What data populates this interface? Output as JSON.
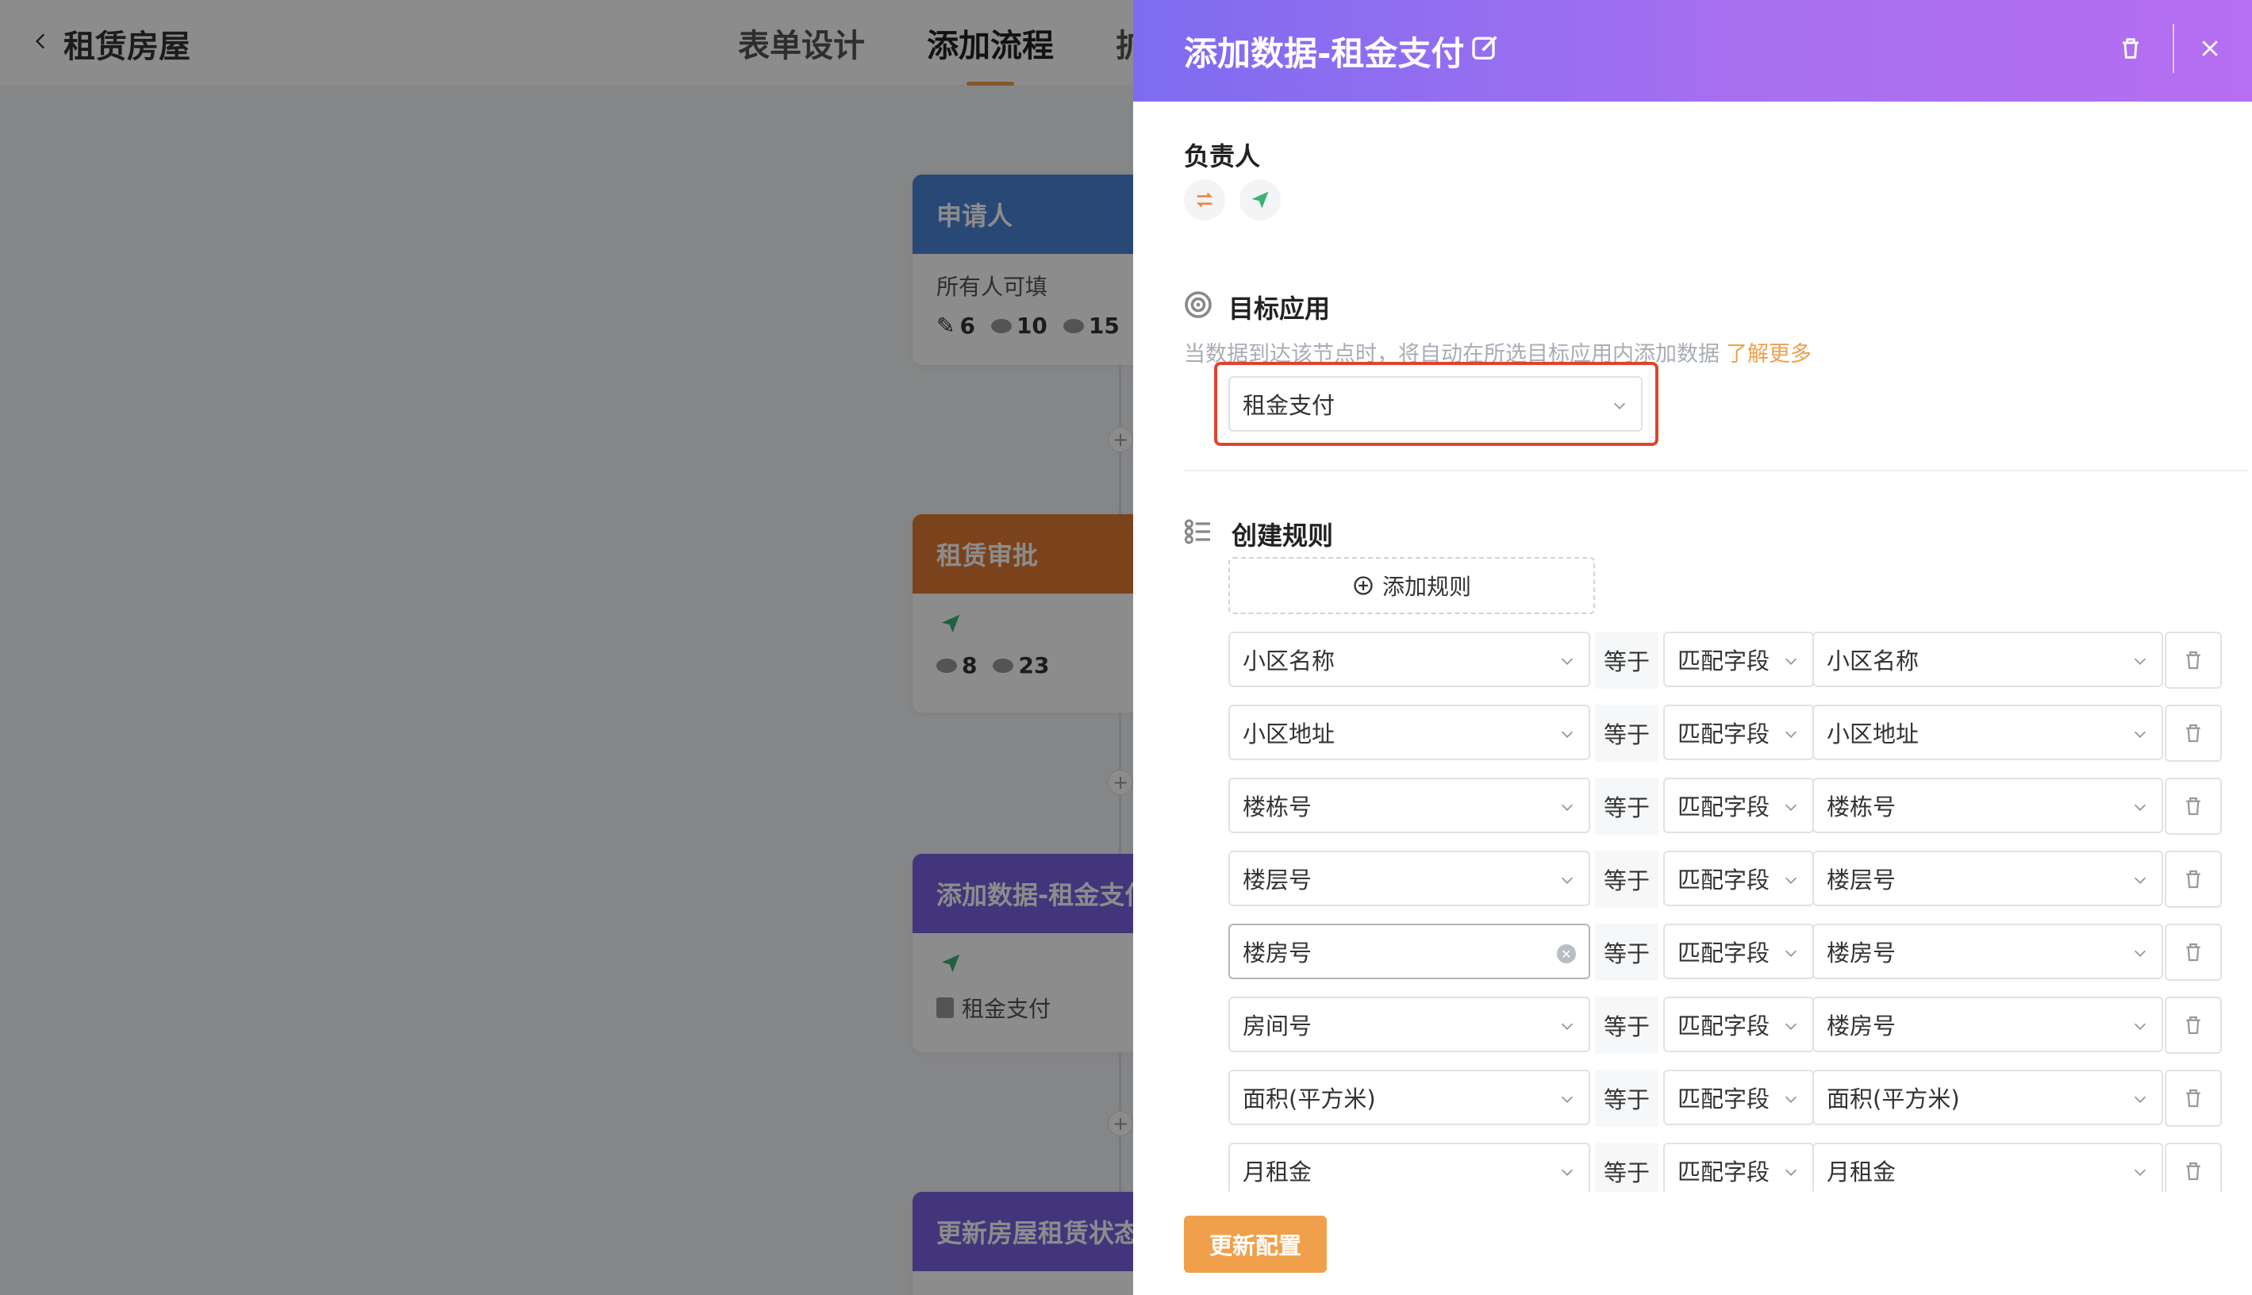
{
  "app": {
    "title": "租赁房屋",
    "tabs": [
      {
        "label": "表单设计"
      },
      {
        "label": "添加流程"
      },
      {
        "label": "扩"
      }
    ]
  },
  "flow": {
    "nodes": [
      {
        "title": "申请人",
        "color": "#4a86d8",
        "desc": "所有人可填",
        "stats": [
          "6",
          "10",
          "15"
        ]
      },
      {
        "title": "租赁审批",
        "color": "#e07b33",
        "stats": [
          "8",
          "23"
        ]
      },
      {
        "title": "添加数据-租金支付",
        "color": "#7b62e0",
        "app_name": "租金支付"
      },
      {
        "title": "更新房屋租赁状态",
        "color": "#7b62e0"
      }
    ]
  },
  "drawer": {
    "title": "添加数据-租金支付",
    "owner_label": "负责人",
    "target_label": "目标应用",
    "target_hint": "当数据到达该节点时，将自动在所选目标应用内添加数据",
    "learn_more": "了解更多",
    "target_app": "租金支付",
    "rules_label": "创建规则",
    "add_rule_label": "添加规则",
    "equals": "等于",
    "rules": [
      {
        "field": "小区名称",
        "mode": "匹配字段",
        "target": "小区名称"
      },
      {
        "field": "小区地址",
        "mode": "匹配字段",
        "target": "小区地址"
      },
      {
        "field": "楼栋号",
        "mode": "匹配字段",
        "target": "楼栋号"
      },
      {
        "field": "楼层号",
        "mode": "匹配字段",
        "target": "楼层号"
      },
      {
        "field": "楼房号",
        "mode": "匹配字段",
        "target": "楼房号"
      },
      {
        "field": "房间号",
        "mode": "匹配字段",
        "target": "楼房号"
      },
      {
        "field": "面积(平方米)",
        "mode": "匹配字段",
        "target": "面积(平方米)"
      },
      {
        "field": "月租金",
        "mode": "匹配字段",
        "target": "月租金"
      }
    ],
    "update_button": "更新配置"
  },
  "colors": {
    "accent": "#f0a04b",
    "highlight": "#e0432f",
    "header_start": "#7e6cf0",
    "header_end": "#b66ef2"
  }
}
